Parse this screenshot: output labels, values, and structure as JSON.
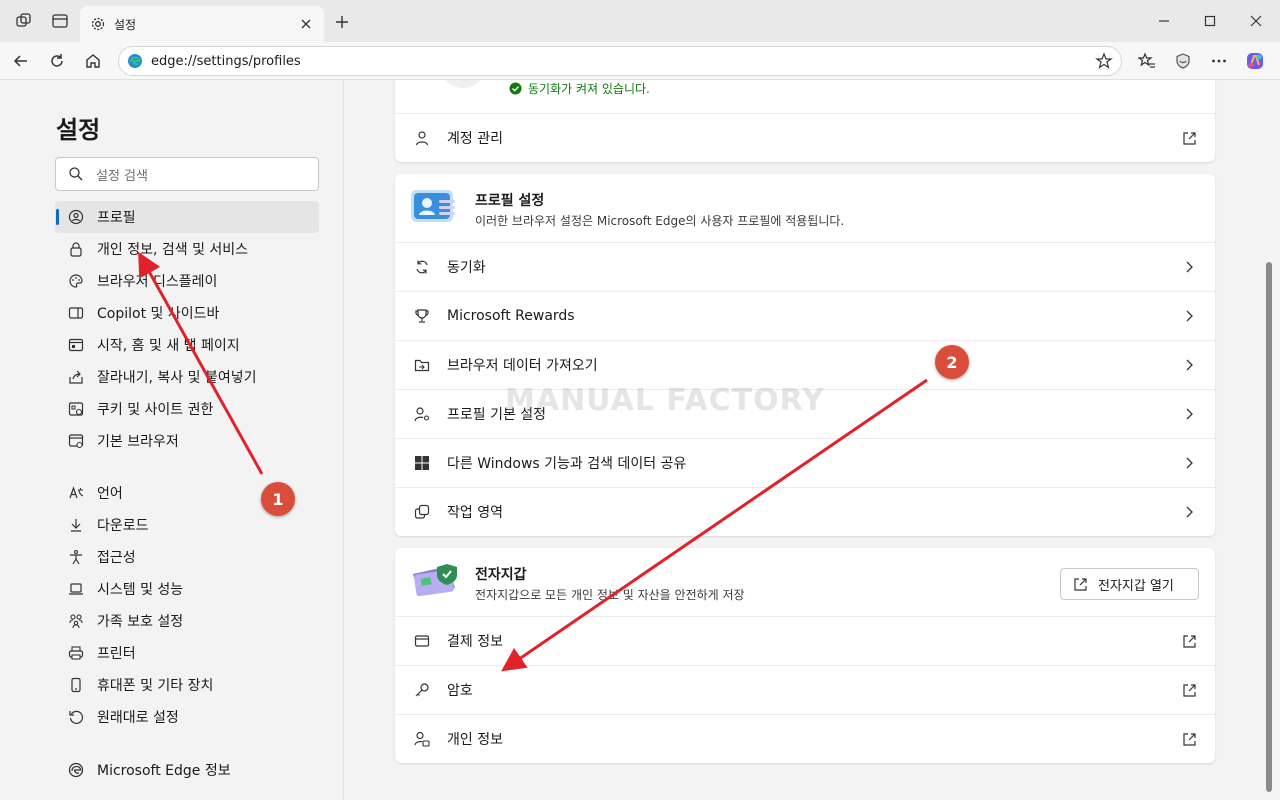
{
  "browser": {
    "tab_title": "설정",
    "url": "edge://settings/profiles"
  },
  "sidebar": {
    "title": "설정",
    "search_placeholder": "설정 검색",
    "items": [
      {
        "label": "프로필",
        "icon": "profile-icon",
        "active": true
      },
      {
        "label": "개인 정보, 검색 및 서비스",
        "icon": "lock-icon"
      },
      {
        "label": "브라우저 디스플레이",
        "icon": "palette-icon"
      },
      {
        "label": "Copilot 및 사이드바",
        "icon": "sidebar-icon"
      },
      {
        "label": "시작, 홈 및 새 탭 페이지",
        "icon": "home-tab-icon"
      },
      {
        "label": "잘라내기, 복사 및 붙여넣기",
        "icon": "share-icon"
      },
      {
        "label": "쿠키 및 사이트 권한",
        "icon": "cookie-icon"
      },
      {
        "label": "기본 브라우저",
        "icon": "browser-icon"
      },
      {
        "label": "언어",
        "icon": "language-icon"
      },
      {
        "label": "다운로드",
        "icon": "download-icon"
      },
      {
        "label": "접근성",
        "icon": "accessibility-icon"
      },
      {
        "label": "시스템 및 성능",
        "icon": "laptop-icon"
      },
      {
        "label": "가족 보호 설정",
        "icon": "family-icon"
      },
      {
        "label": "프린터",
        "icon": "printer-icon"
      },
      {
        "label": "휴대폰 및 기타 장치",
        "icon": "phone-icon"
      },
      {
        "label": "원래대로 설정",
        "icon": "reset-icon"
      },
      {
        "label": "Microsoft Edge 정보",
        "icon": "edge-icon"
      }
    ]
  },
  "main": {
    "sync_status": "동기화가 켜져 있습니다.",
    "account_manage": "계정 관리",
    "profile_settings": {
      "title": "프로필 설정",
      "description": "이러한 브라우저 설정은 Microsoft Edge의 사용자 프로필에 적용됩니다.",
      "rows": [
        {
          "label": "동기화",
          "icon": "sync-icon"
        },
        {
          "label": "Microsoft Rewards",
          "icon": "trophy-icon"
        },
        {
          "label": "브라우저 데이터 가져오기",
          "icon": "import-icon"
        },
        {
          "label": "프로필 기본 설정",
          "icon": "profile-settings-icon"
        },
        {
          "label": "다른 Windows 기능과 검색 데이터 공유",
          "icon": "windows-icon"
        },
        {
          "label": "작업 영역",
          "icon": "workspaces-icon"
        }
      ]
    },
    "wallet": {
      "title": "전자지갑",
      "description": "전자지갑으로 모든 개인 정보 및 자산을 안전하게 저장",
      "open_button": "전자지갑 열기",
      "rows": [
        {
          "label": "결제 정보",
          "icon": "card-icon"
        },
        {
          "label": "암호",
          "icon": "key-icon"
        },
        {
          "label": "개인 정보",
          "icon": "person-info-icon"
        }
      ]
    }
  },
  "watermark": "MANUAL FACTORY",
  "annotations": {
    "badge1": "1",
    "badge2": "2",
    "color": "#d94e3a",
    "arrow_color": "#e0232b"
  }
}
